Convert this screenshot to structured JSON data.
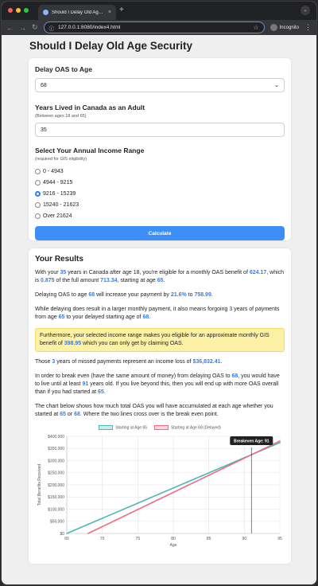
{
  "browser": {
    "tab_title": "Should I Delay Old Age Secu...",
    "tab_close": "×",
    "new_tab": "+",
    "url": "127.0.0.1:8080/index4.html",
    "incognito_label": "Incognito"
  },
  "page": {
    "title": "Should I Delay Old Age Security"
  },
  "form": {
    "delay_label": "Delay OAS to Age",
    "delay_value": "68",
    "years_label": "Years Lived in Canada as an Adult",
    "years_hint": "(Between ages 18 and 65)",
    "years_value": "35",
    "income_label": "Select Your Annual Income Range",
    "income_hint": "(required for GIS eligibility)",
    "income_options": [
      "0 - 4943",
      "4944 - 9215",
      "9216 - 15239",
      "15240 - 21623",
      "Over 21624"
    ],
    "income_selected_index": 2,
    "calculate_label": "Calculate"
  },
  "results": {
    "heading": "Your Results",
    "p1": {
      "a": "With your ",
      "years": "35",
      "b": " years in Canada after age 18, you're eligible for a monthly OAS benefit of ",
      "monthly": "624.17",
      "c": ", which is ",
      "fraction": "0.875",
      "d": " of the full amount ",
      "full": "713.34",
      "e": ", starting at age ",
      "age": "65",
      "f": "."
    },
    "p2": {
      "a": "Delaying OAS to age ",
      "age": "68",
      "b": " will increase your payment by ",
      "pct": "21.6%",
      "c": " to ",
      "amount": "758.99",
      "d": "."
    },
    "p3": {
      "a": "While delaying does result in a larger monthly payment, it also means forgoing ",
      "years": "3",
      "b": " years of payments from age ",
      "start": "65",
      "c": " to your delayed starting age of ",
      "delay": "68",
      "d": "."
    },
    "note": {
      "a": "Furthermore, your selected income range makes you eligible for an approximate monthly GIS benefit of ",
      "gis": "398.95",
      "b": " which you can only get by claiming OAS."
    },
    "p4": {
      "a": "Those ",
      "years": "3",
      "b": " years of missed payments represent an income loss of ",
      "loss": "$36,832.41",
      "c": "."
    },
    "p5": {
      "a": "In order to break even (have the same amount of money) from delaying OAS to ",
      "delay": "68",
      "b": ", you would have to live until at least ",
      "breakeven": "91",
      "c": " years old. If you live beyond this, then you will end up with more OAS overall than if you had started at ",
      "start": "65",
      "d": "."
    },
    "p6": {
      "a": "The chart below shows how much total OAS you will have accumulated at each age whether you started at ",
      "start": "65",
      "b": " or ",
      "delay": "68",
      "c": ". Where the two lines cross over is the break even point."
    }
  },
  "chart_data": {
    "type": "line",
    "xlabel": "Age",
    "ylabel": "Total Benefits Received",
    "xlim": [
      65,
      95
    ],
    "ylim": [
      0,
      400000
    ],
    "xticks": [
      65,
      70,
      75,
      80,
      85,
      90,
      95
    ],
    "yticks": [
      0,
      50000,
      100000,
      150000,
      200000,
      250000,
      300000,
      350000,
      400000
    ],
    "ytick_labels": [
      "$0",
      "$50,000",
      "$100,000",
      "$150,000",
      "$200,000",
      "$250,000",
      "$300,000",
      "$350,000",
      "$400,000"
    ],
    "series": [
      {
        "name": "Starting at Age 65",
        "color": "#4bb8b8",
        "x": [
          65,
          95
        ],
        "y": [
          0,
          374200
        ]
      },
      {
        "name": "Starting at Age 68 (Delayed)",
        "color": "#f06a86",
        "x": [
          68,
          95
        ],
        "y": [
          0,
          380500
        ]
      }
    ],
    "annotation": {
      "label": "Breakeven Age: 91",
      "x": 91
    },
    "legend": "top",
    "grid": true
  }
}
